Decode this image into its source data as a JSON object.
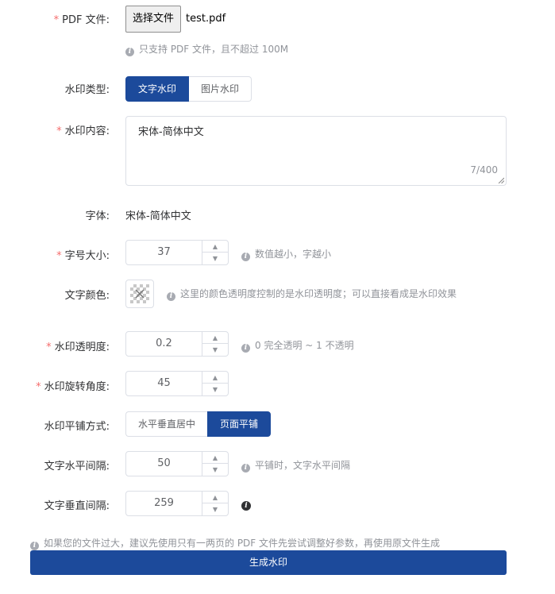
{
  "file": {
    "label": "PDF 文件:",
    "button_label": "选择文件",
    "file_name": "test.pdf",
    "hint": "只支持 PDF 文件，且不超过 100M"
  },
  "watermark_type": {
    "label": "水印类型:",
    "options": [
      "文字水印",
      "图片水印"
    ],
    "selected": "文字水印"
  },
  "content": {
    "label": "水印内容:",
    "value": "宋体-简体中文",
    "counter": "7/400"
  },
  "font": {
    "label": "字体:",
    "value": "宋体-简体中文"
  },
  "font_size": {
    "label": "字号大小:",
    "value": "37",
    "hint": "数值越小，字越小"
  },
  "text_color": {
    "label": "文字颜色:",
    "hint": "这里的颜色透明度控制的是水印透明度；可以直接看成是水印效果"
  },
  "opacity": {
    "label": "水印透明度:",
    "value": "0.2",
    "hint": "0 完全透明 ~ 1 不透明"
  },
  "rotation": {
    "label": "水印旋转角度:",
    "value": "45"
  },
  "tiling": {
    "label": "水印平铺方式:",
    "options": [
      "水平垂直居中",
      "页面平铺"
    ],
    "selected": "页面平铺"
  },
  "h_spacing": {
    "label": "文字水平间隔:",
    "value": "50",
    "hint": "平铺时，文字水平间隔"
  },
  "v_spacing": {
    "label": "文字垂直间隔:",
    "value": "259"
  },
  "footer_hint": "如果您的文件过大，建议先使用只有一两页的 PDF 文件先尝试调整好参数，再使用原文件生成",
  "submit_label": "生成水印",
  "colors": {
    "primary": "#1c4a9b",
    "required": "#f56c6c",
    "border": "#dcdfe6",
    "hint": "#909399"
  }
}
